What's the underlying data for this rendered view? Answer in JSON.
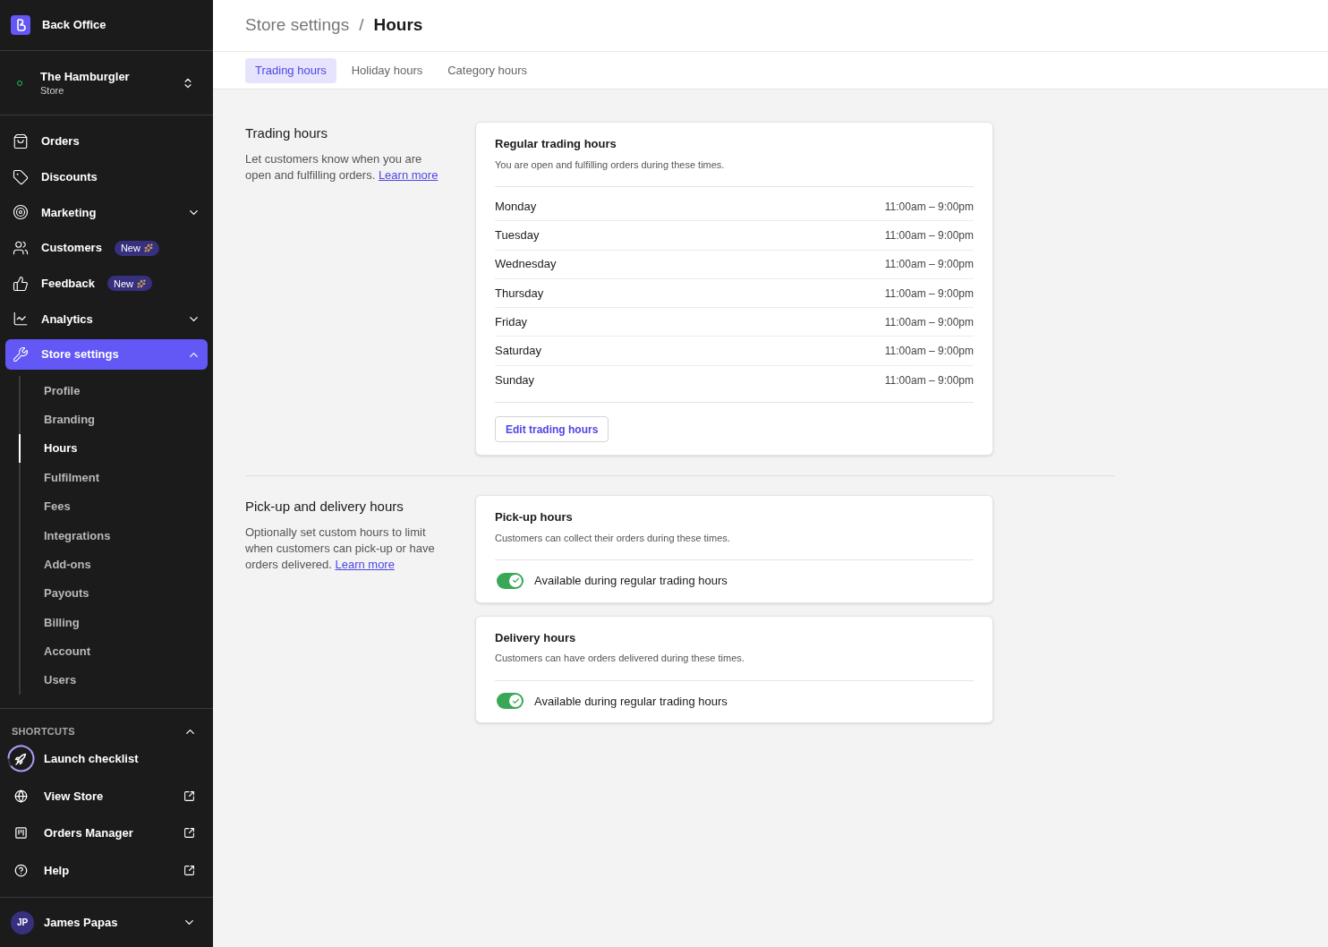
{
  "app": {
    "name": "Back Office"
  },
  "store": {
    "name": "The Hamburgler",
    "type": "Store"
  },
  "nav": [
    {
      "label": "Orders",
      "kind": "link"
    },
    {
      "label": "Discounts",
      "kind": "link"
    },
    {
      "label": "Marketing",
      "kind": "group",
      "expanded": false,
      "selected": false
    },
    {
      "label": "Customers",
      "kind": "link",
      "badge": "New"
    },
    {
      "label": "Feedback",
      "kind": "link",
      "badge": "New"
    },
    {
      "label": "Analytics",
      "kind": "group",
      "expanded": false,
      "selected": false
    },
    {
      "label": "Store settings",
      "kind": "group",
      "expanded": true,
      "selected": true,
      "children": [
        {
          "label": "Profile",
          "selected": false
        },
        {
          "label": "Branding",
          "selected": false
        },
        {
          "label": "Hours",
          "selected": true
        },
        {
          "label": "Fulfilment",
          "selected": false
        },
        {
          "label": "Fees",
          "selected": false
        },
        {
          "label": "Integrations",
          "selected": false
        },
        {
          "label": "Add-ons",
          "selected": false
        },
        {
          "label": "Payouts",
          "selected": false
        },
        {
          "label": "Billing",
          "selected": false
        },
        {
          "label": "Account",
          "selected": false
        },
        {
          "label": "Users",
          "selected": false
        }
      ]
    }
  ],
  "shortcuts": {
    "title": "SHORTCUTS",
    "expanded": true,
    "items": [
      {
        "label": "Launch checklist",
        "kind": "progress"
      },
      {
        "label": "View Store",
        "kind": "external"
      },
      {
        "label": "Orders Manager",
        "kind": "external"
      },
      {
        "label": "Help",
        "kind": "external"
      }
    ]
  },
  "user": {
    "initials": "JP",
    "name": "James Papas"
  },
  "breadcrumb": [
    "Store settings",
    "/",
    "Hours"
  ],
  "tabs": [
    {
      "label": "Trading hours",
      "selected": true
    },
    {
      "label": "Holiday hours",
      "selected": false
    },
    {
      "label": "Category hours",
      "selected": false
    }
  ],
  "sections": [
    {
      "title": "Trading hours",
      "description": "Let customers know when you are open and fulfilling orders.",
      "link": "Learn more",
      "cards": [
        {
          "kind": "schedule",
          "title": "Regular trading hours",
          "subtitle": "You are open and fulfilling orders during these times.",
          "rows": [
            {
              "day": "Monday",
              "hours": "11:00am – 9:00pm"
            },
            {
              "day": "Tuesday",
              "hours": "11:00am – 9:00pm"
            },
            {
              "day": "Wednesday",
              "hours": "11:00am – 9:00pm"
            },
            {
              "day": "Thursday",
              "hours": "11:00am – 9:00pm"
            },
            {
              "day": "Friday",
              "hours": "11:00am – 9:00pm"
            },
            {
              "day": "Saturday",
              "hours": "11:00am – 9:00pm"
            },
            {
              "day": "Sunday",
              "hours": "11:00am – 9:00pm"
            }
          ],
          "button": "Edit trading hours"
        }
      ]
    },
    {
      "title": "Pick-up and delivery hours",
      "description": "Optionally set custom hours to limit when customers can pick-up or have orders delivered.",
      "link": "Learn more",
      "cards": [
        {
          "kind": "toggle",
          "title": "Pick-up hours",
          "subtitle": "Customers can collect their orders during these times.",
          "toggle": {
            "label": "Available during regular trading hours",
            "on": true
          }
        },
        {
          "kind": "toggle",
          "title": "Delivery hours",
          "subtitle": "Customers can have orders delivered during these times.",
          "toggle": {
            "label": "Available during regular trading hours",
            "on": true
          }
        }
      ]
    }
  ]
}
